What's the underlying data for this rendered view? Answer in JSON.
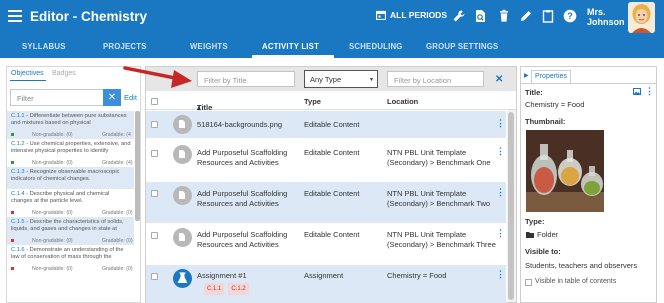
{
  "app": {
    "title": "Editor - Chemistry"
  },
  "header": {
    "all_periods": "ALL PERIODS",
    "user_line1": "Mrs.",
    "user_line2": "Johnson"
  },
  "nav": {
    "tabs": [
      "SYLLABUS",
      "PROJECTS",
      "WEIGHTS",
      "ACTIVITY LIST",
      "SCHEDULING",
      "GROUP SETTINGS"
    ],
    "active": "ACTIVITY LIST"
  },
  "left_panel": {
    "tabs": [
      "Objectives",
      "Badges"
    ],
    "filter_placeholder": "Filter",
    "edit_label": "Edit",
    "objectives": [
      {
        "code": "C.1.1",
        "text": " - Differentiate between pure substances and mixtures based on physical",
        "nongradable": "Non-gradable: (0)",
        "gradable": "Gradable: (4",
        "status_color": "#2e9b3e",
        "shaded": true
      },
      {
        "code": "C.1.2",
        "text": " - Use chemical properties, extensive, and intensive physical properties to identify",
        "nongradable": "Non-gradable: (0)",
        "gradable": "Gradable: (4)",
        "status_color": "#2e9b3e",
        "shaded": false
      },
      {
        "code": "C.1.3",
        "text": " - Recognize observable macroscopic indicators of chemical changes.",
        "nongradable": "",
        "gradable": "",
        "status_color": "",
        "shaded": true
      },
      {
        "code": "C.1.4",
        "text": " - Describe physical and chemical changes at the particle level.",
        "nongradable": "Non-gradable: (0)",
        "gradable": "Gradable: (0)",
        "status_color": "#d9302c",
        "shaded": false
      },
      {
        "code": "C.1.5",
        "text": " - Describe the characteristics of solids, liquids, and gases and changes in state at",
        "nongradable": "Non-gradable: (0)",
        "gradable": "Gradable: (0)",
        "status_color": "#d9302c",
        "shaded": true
      },
      {
        "code": "C.1.6",
        "text": " - Demonstrate an understanding of the law of conservation of mass through the",
        "nongradable": "Non-gradable: (0)",
        "gradable": "Gradable: (0)",
        "status_color": "#d9302c",
        "shaded": false
      }
    ]
  },
  "toolbar": {
    "title_placeholder": "Filter by Title",
    "type_selected": "Any Type",
    "location_placeholder": "Filter by Location"
  },
  "table": {
    "headers": {
      "title": "Title",
      "type": "Type",
      "location": "Location"
    },
    "sort_indicator": "▴",
    "rows": [
      {
        "title": "518164-backgrounds.png",
        "type": "Editable Content",
        "location": "",
        "icon": "file-icon"
      },
      {
        "title": "Add Purposeful Scaffolding Resources and Activities",
        "type": "Editable Content",
        "location": "NTN PBL Unit Template (Secondary) > Benchmark One",
        "icon": "file-icon"
      },
      {
        "title": "Add Purposeful Scaffolding Resources and Activities",
        "type": "Editable Content",
        "location": "NTN PBL Unit Template (Secondary) > Benchmark Two",
        "icon": "file-icon"
      },
      {
        "title": "Add Purposeful Scaffolding Resources and Activities",
        "type": "Editable Content",
        "location": "NTN PBL Unit Template (Secondary) > Benchmark Three",
        "icon": "file-icon"
      },
      {
        "title": "Assignment #1",
        "type": "Assignment",
        "location": "Chemistry = Food",
        "icon": "flask-icon",
        "badges": [
          "C.1.1",
          "C.1.2"
        ]
      }
    ]
  },
  "properties": {
    "tab_label": "Properties",
    "title_label": "Title:",
    "title_value": "Chemistry = Food",
    "thumbnail_label": "Thumbnail:",
    "type_label": "Type:",
    "type_value": "Folder",
    "visible_label": "Visible to:",
    "visible_value": "Students, teachers and observers",
    "toc_label": "Visible in table of contents"
  },
  "colors": {
    "primary": "#1a78c2",
    "row_shade": "#dce8f5",
    "annotation_arrow": "#c62828"
  }
}
